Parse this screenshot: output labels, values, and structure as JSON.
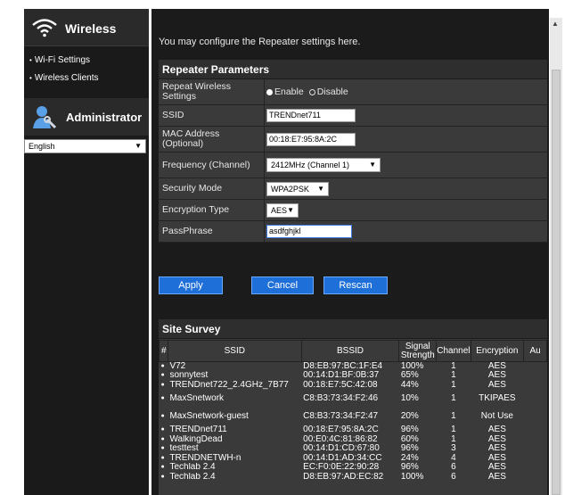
{
  "sidebar": {
    "section_title": "Wireless",
    "items": [
      {
        "label": "Wi-Fi Settings"
      },
      {
        "label": "Wireless Clients"
      }
    ],
    "admin_title": "Administrator",
    "language": "English"
  },
  "main": {
    "intro": "You may configure the Repeater settings here.",
    "repeater": {
      "title": "Repeater Parameters",
      "repeat_label": "Repeat Wireless Settings",
      "enable_label": "Enable",
      "disable_label": "Disable",
      "ssid_label": "SSID",
      "ssid_value": "TRENDnet711",
      "mac_label": "MAC Address (Optional)",
      "mac_value": "00:18:E7:95:8A:2C",
      "freq_label": "Frequency (Channel)",
      "freq_value": "2412MHz (Channel 1)",
      "security_label": "Security Mode",
      "security_value": "WPA2PSK",
      "encryption_label": "Encryption Type",
      "encryption_value": "AES",
      "pass_label": "PassPhrase",
      "pass_value": "asdfghjkl"
    },
    "buttons": {
      "apply": "Apply",
      "cancel": "Cancel",
      "rescan": "Rescan"
    },
    "survey": {
      "title": "Site Survey",
      "headers": [
        "#",
        "SSID",
        "BSSID",
        "Signal Strength",
        "Channel",
        "Encryption",
        "Au"
      ],
      "rows": [
        {
          "ssid": "V72",
          "bssid": "D8:EB:97:BC:1F:E4",
          "signal": "100%",
          "channel": "1",
          "enc": "AES"
        },
        {
          "ssid": "sonnytest",
          "bssid": "00:14:D1:BF:0B:37",
          "signal": "65%",
          "channel": "1",
          "enc": "AES"
        },
        {
          "ssid": "TRENDnet722_2.4GHz_7B77",
          "bssid": "00:18:E7:5C:42:08",
          "signal": "44%",
          "channel": "1",
          "enc": "AES"
        },
        {
          "ssid": "MaxSnetwork",
          "bssid": "C8:B3:73:34:F2:46",
          "signal": "10%",
          "channel": "1",
          "enc": "TKIPAES"
        },
        {
          "ssid": "MaxSnetwork-guest",
          "bssid": "C8:B3:73:34:F2:47",
          "signal": "20%",
          "channel": "1",
          "enc": "Not Use"
        },
        {
          "ssid": "TRENDnet711",
          "bssid": "00:18:E7:95:8A:2C",
          "signal": "96%",
          "channel": "1",
          "enc": "AES"
        },
        {
          "ssid": "WalkingDead",
          "bssid": "00:E0:4C:81:86:82",
          "signal": "60%",
          "channel": "1",
          "enc": "AES"
        },
        {
          "ssid": "testtest",
          "bssid": "00:14:D1:CD:67:80",
          "signal": "96%",
          "channel": "3",
          "enc": "AES"
        },
        {
          "ssid": "TRENDNETWH-n",
          "bssid": "00:14:D1:AD:34:CC",
          "signal": "24%",
          "channel": "4",
          "enc": "AES"
        },
        {
          "ssid": "Techlab 2.4",
          "bssid": "EC:F0:0E:22:90:28",
          "signal": "96%",
          "channel": "6",
          "enc": "AES"
        },
        {
          "ssid": "Techlab 2.4",
          "bssid": "D8:EB:97:AD:EC:82",
          "signal": "100%",
          "channel": "6",
          "enc": "AES"
        }
      ]
    }
  },
  "colors": {
    "accent": "#1e6fd8",
    "panel": "#3a3a3a",
    "background": "#1b1b1b"
  }
}
